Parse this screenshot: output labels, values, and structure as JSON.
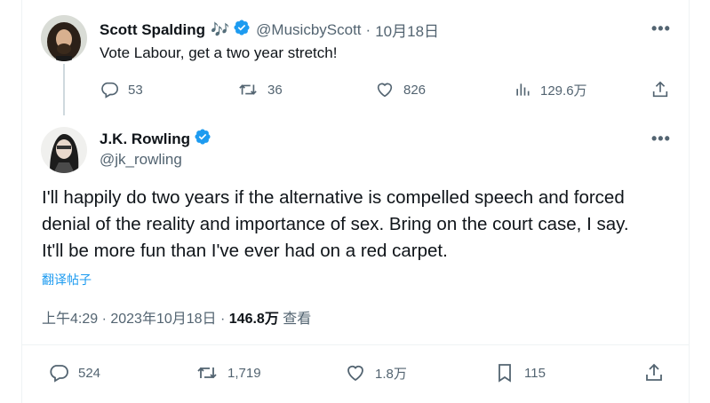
{
  "reply_tweet": {
    "author_name": "Scott Spalding",
    "author_emoji": "🎶",
    "handle": "@MusicbyScott",
    "separator": "·",
    "date": "10月18日",
    "text": "Vote Labour, get a two year stretch!",
    "replies": "53",
    "retweets": "36",
    "likes": "826",
    "views": "129.6万"
  },
  "main_tweet": {
    "author_name": "J.K. Rowling",
    "handle": "@jk_rowling",
    "text_lines": [
      "I'll happily do two years if the alternative is compelled speech and forced",
      "denial of the reality and importance of sex. Bring on the court case, I say.",
      "It'll be more fun than I've ever had on a red carpet."
    ],
    "translate_label": "翻译帖子",
    "timestamp": "上午4:29 · 2023年10月18日 · ",
    "views_count": "146.8万",
    "views_label": " 查看",
    "replies": "524",
    "retweets": "1,719",
    "likes": "1.8万",
    "bookmarks": "115"
  },
  "icons": {
    "verified": "verified-badge-icon",
    "more": "more-icon",
    "reply": "reply-icon",
    "retweet": "retweet-icon",
    "like": "heart-icon",
    "views": "views-icon",
    "share": "share-icon",
    "bookmark": "bookmark-icon"
  },
  "colors": {
    "accent": "#1d9bf0",
    "text": "#0f1419",
    "secondary": "#536471"
  }
}
